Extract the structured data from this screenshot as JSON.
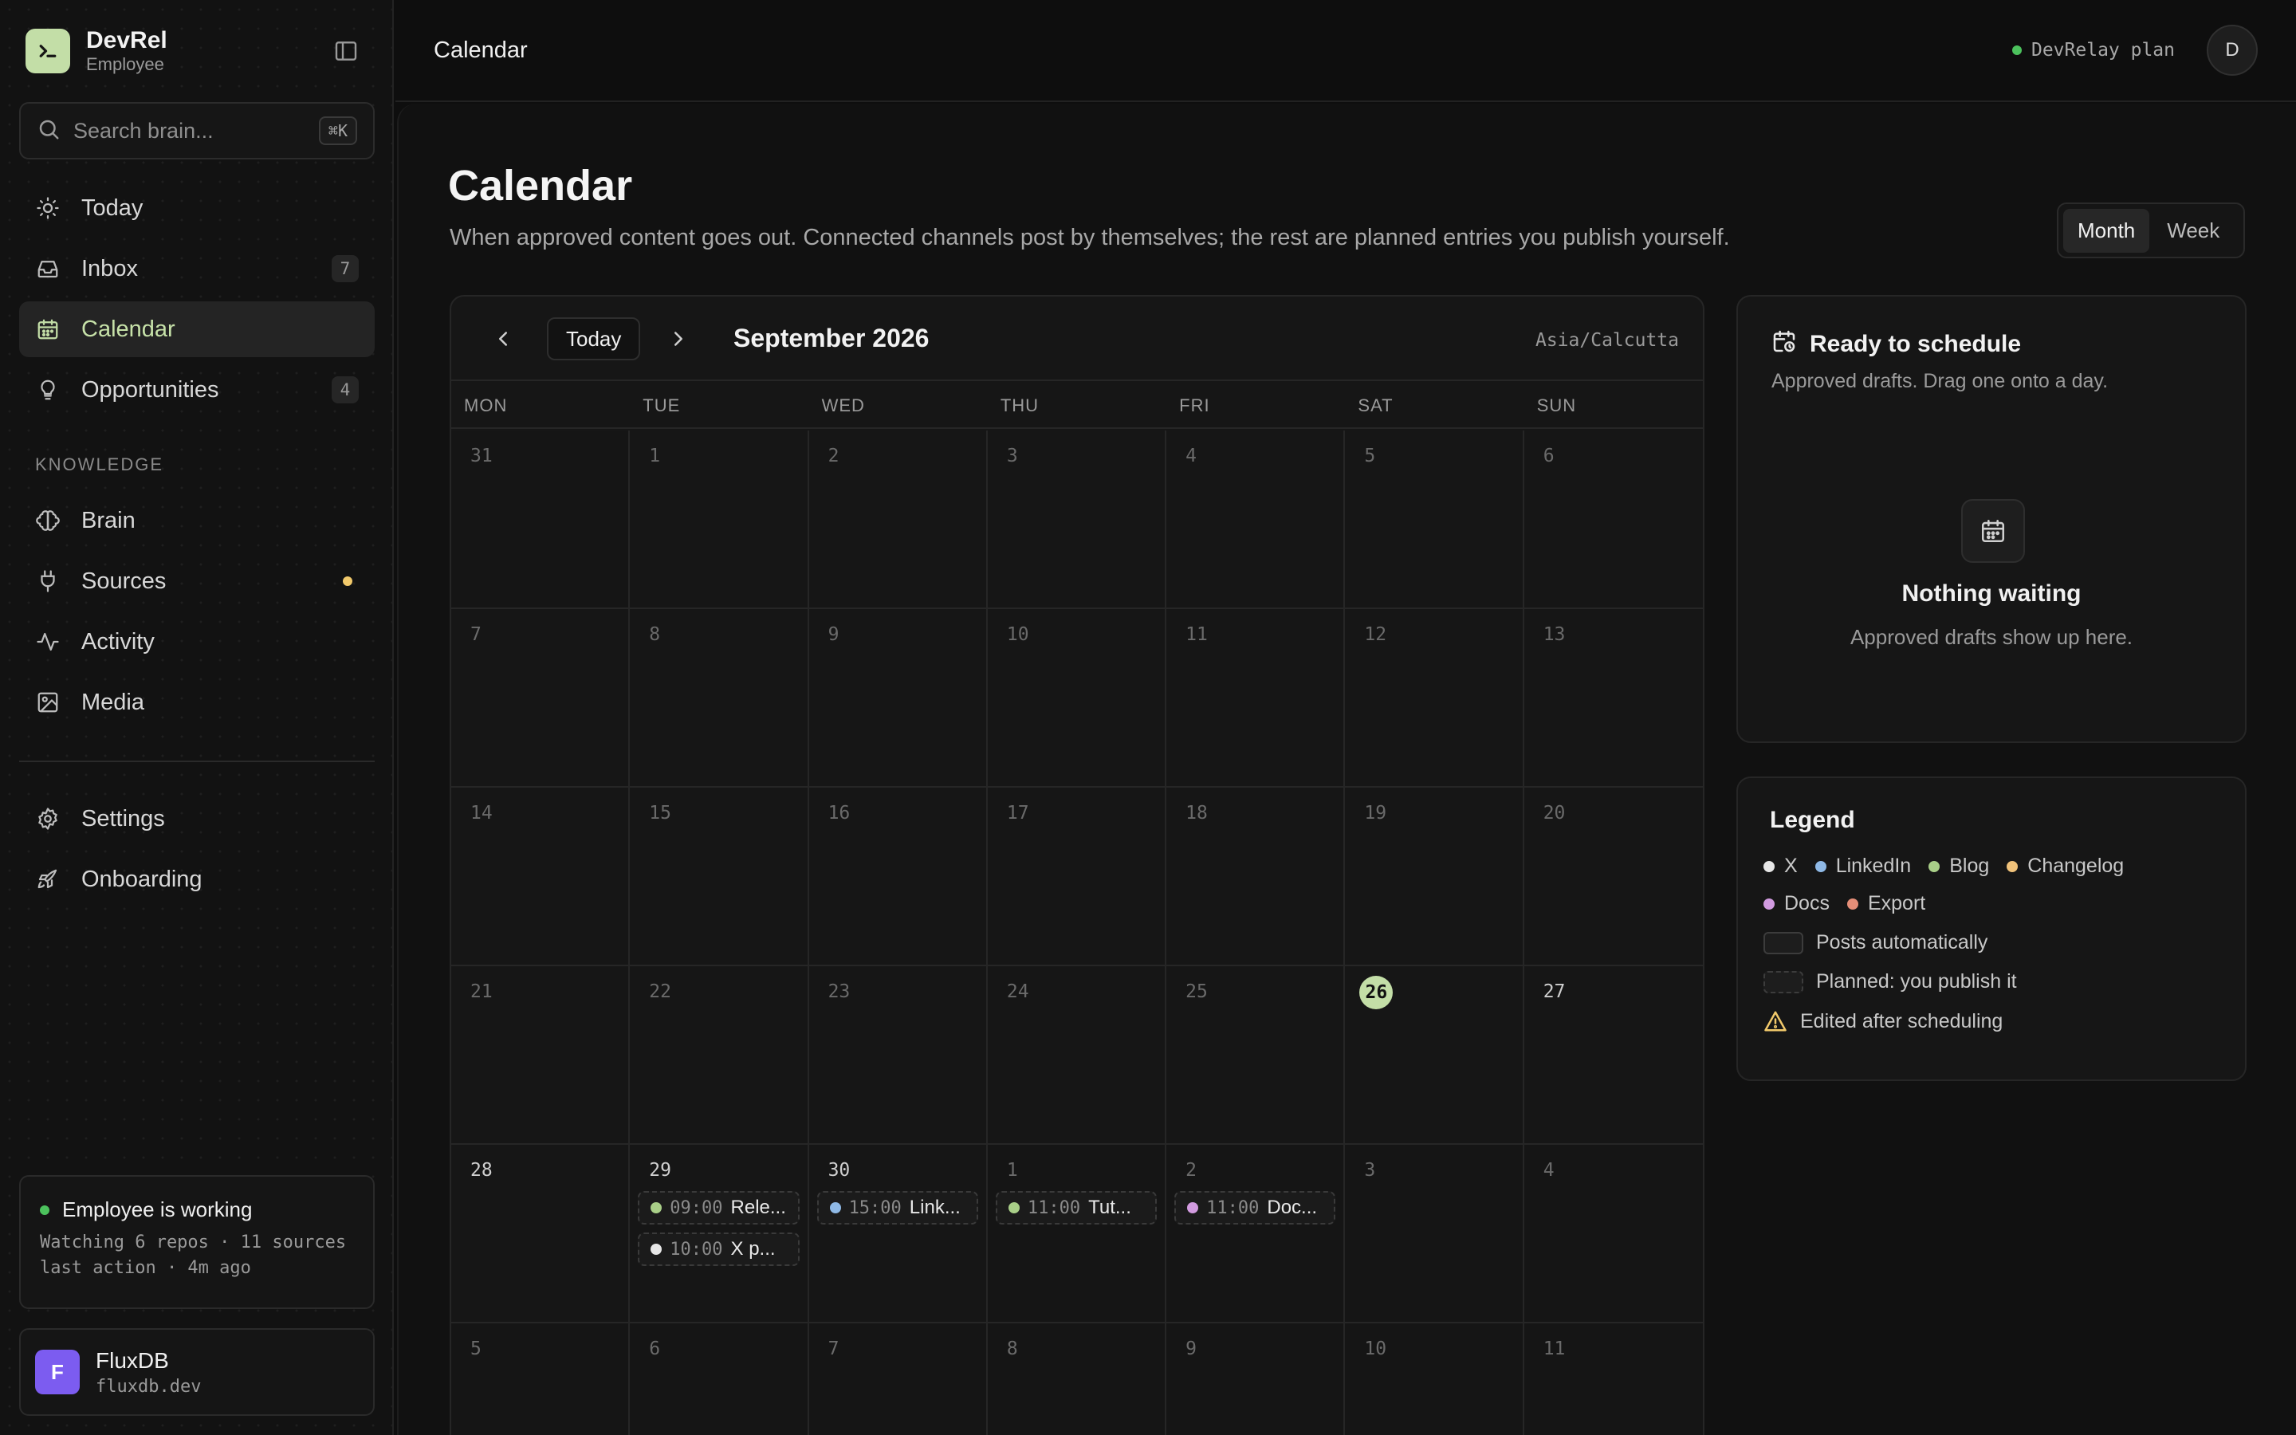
{
  "app": {
    "name": "DevRel",
    "role": "Employee"
  },
  "search": {
    "placeholder": "Search brain...",
    "shortcut": "⌘K"
  },
  "nav": {
    "today": "Today",
    "inbox": "Inbox",
    "inbox_count": "7",
    "calendar": "Calendar",
    "opportunities": "Opportunities",
    "opportunities_count": "4",
    "knowledge_label": "KNOWLEDGE",
    "brain": "Brain",
    "sources": "Sources",
    "activity": "Activity",
    "media": "Media",
    "settings": "Settings",
    "onboarding": "Onboarding"
  },
  "status": {
    "title": "Employee is working",
    "line1": "Watching 6 repos · 11 sources",
    "line2": "last action · 4m ago"
  },
  "workspace": {
    "initial": "F",
    "name": "FluxDB",
    "domain": "fluxdb.dev"
  },
  "topbar": {
    "title": "Calendar",
    "plan": "DevRelay plan",
    "avatar": "D"
  },
  "page": {
    "title": "Calendar",
    "subtitle": "When approved content goes out. Connected channels post by themselves; the rest are planned entries you publish yourself.",
    "view_month": "Month",
    "view_week": "Week"
  },
  "calendar": {
    "today_label": "Today",
    "month": "September 2026",
    "timezone": "Asia/Calcutta",
    "dow": [
      "MON",
      "TUE",
      "WED",
      "THU",
      "FRI",
      "SAT",
      "SUN"
    ],
    "weeks": [
      [
        {
          "d": "31",
          "m": true
        },
        {
          "d": "1"
        },
        {
          "d": "2"
        },
        {
          "d": "3"
        },
        {
          "d": "4"
        },
        {
          "d": "5"
        },
        {
          "d": "6"
        }
      ],
      [
        {
          "d": "7"
        },
        {
          "d": "8"
        },
        {
          "d": "9"
        },
        {
          "d": "10"
        },
        {
          "d": "11"
        },
        {
          "d": "12"
        },
        {
          "d": "13"
        }
      ],
      [
        {
          "d": "14"
        },
        {
          "d": "15"
        },
        {
          "d": "16"
        },
        {
          "d": "17"
        },
        {
          "d": "18"
        },
        {
          "d": "19"
        },
        {
          "d": "20"
        }
      ],
      [
        {
          "d": "21"
        },
        {
          "d": "22"
        },
        {
          "d": "23"
        },
        {
          "d": "24"
        },
        {
          "d": "25"
        },
        {
          "d": "26",
          "today": true
        },
        {
          "d": "27",
          "current": true
        }
      ],
      [
        {
          "d": "28",
          "current": true
        },
        {
          "d": "29",
          "current": true,
          "events": [
            {
              "time": "09:00",
              "title": "Rele...",
              "channel": "blog"
            },
            {
              "time": "10:00",
              "title": "X p...",
              "channel": "x"
            }
          ]
        },
        {
          "d": "30",
          "current": true,
          "events": [
            {
              "time": "15:00",
              "title": "Link...",
              "channel": "linkedin"
            }
          ]
        },
        {
          "d": "1",
          "m": true,
          "events": [
            {
              "time": "11:00",
              "title": "Tut...",
              "channel": "blog"
            }
          ]
        },
        {
          "d": "2",
          "m": true,
          "events": [
            {
              "time": "11:00",
              "title": "Doc...",
              "channel": "docs"
            }
          ]
        },
        {
          "d": "3",
          "m": true
        },
        {
          "d": "4",
          "m": true
        }
      ],
      [
        {
          "d": "5",
          "m": true
        },
        {
          "d": "6",
          "m": true
        },
        {
          "d": "7",
          "m": true
        },
        {
          "d": "8",
          "m": true
        },
        {
          "d": "9",
          "m": true
        },
        {
          "d": "10",
          "m": true
        },
        {
          "d": "11",
          "m": true
        }
      ]
    ]
  },
  "ready": {
    "title": "Ready to schedule",
    "subtitle": "Approved drafts. Drag one onto a day.",
    "empty_title": "Nothing waiting",
    "empty_subtitle": "Approved drafts show up here."
  },
  "legend": {
    "title": "Legend",
    "channels": [
      {
        "key": "x",
        "label": "X"
      },
      {
        "key": "linkedin",
        "label": "LinkedIn"
      },
      {
        "key": "blog",
        "label": "Blog"
      },
      {
        "key": "changelog",
        "label": "Changelog"
      },
      {
        "key": "docs",
        "label": "Docs"
      },
      {
        "key": "export",
        "label": "Export"
      }
    ],
    "auto": "Posts automatically",
    "planned": "Planned: you publish it",
    "edited": "Edited after scheduling"
  },
  "colors": {
    "accent": "#c3dea7",
    "x": "#e6e6e6",
    "linkedin": "#8fb9e6",
    "blog": "#a9cf88",
    "changelog": "#f0c27a",
    "docs": "#d29be0",
    "export": "#e58e78",
    "online": "#4cc25d",
    "warning": "#f1c96b"
  }
}
